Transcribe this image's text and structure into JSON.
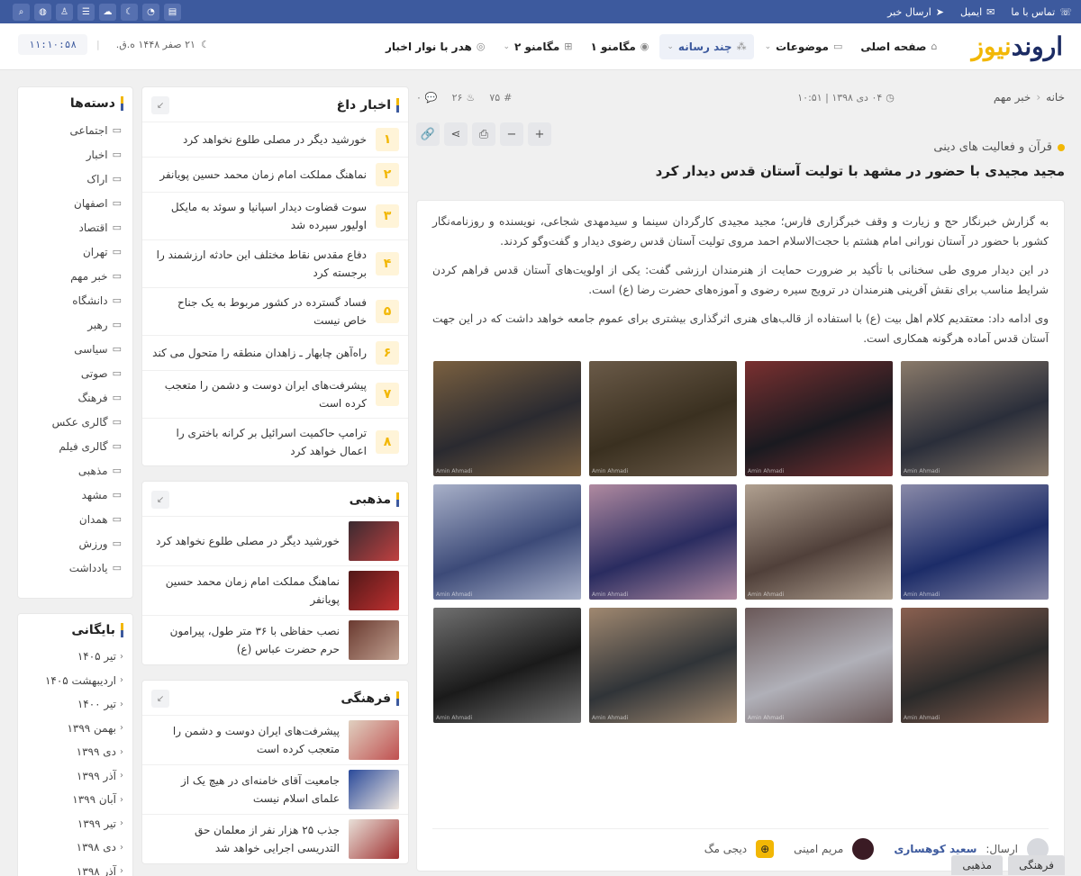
{
  "topbar": {
    "contact": "تماس با ما",
    "email": "ایمیل",
    "send_news": "ارسال خبر",
    "icons": [
      "search-icon",
      "dribbble-icon",
      "user-icon",
      "database-icon",
      "cloud-icon",
      "moon-icon",
      "rss-icon",
      "database-2-icon"
    ]
  },
  "header": {
    "logo_main": "اروند",
    "logo_accent": "نیوز",
    "nav": [
      {
        "label": "صفحه اصلی",
        "icon": "home-icon"
      },
      {
        "label": "موضوعات",
        "icon": "folder-icon",
        "dropdown": true
      },
      {
        "label": "چند رسانه",
        "icon": "grid-icon",
        "dropdown": true,
        "active": true
      },
      {
        "label": "مگامنو ۱",
        "icon": "signal-icon"
      },
      {
        "label": "مگامنو ۲",
        "icon": "sitemap-icon",
        "dropdown": true
      },
      {
        "label": "هدر با نوار اخبار",
        "icon": "target-icon"
      }
    ],
    "clock": "۱۱:۱۰:۵۸",
    "date": "۲۱ صفر ۱۴۴۸ ه.ق."
  },
  "article": {
    "breadcrumb": [
      "خانه",
      "خبر مهم"
    ],
    "date": "۰۴ دی ۱۳۹۸ | ۱۰:۵۱",
    "id": "۷۵",
    "likes": "۲۶",
    "comments": "۰",
    "kicker": "قرآن و فعالیت های دینی",
    "title": "مجید مجیدی با حضور در مشهد با تولیت آستان قدس دیدار کرد",
    "paragraphs": [
      "به گزارش خبرنگار حج و زیارت و وقف خبرگزاری فارس؛ مجید مجیدی کارگردان سینما و سیدمهدی شجاعی، نویسنده و روزنامه‌نگار کشور با حضور در آستان نورانی امام هشتم با حجت‌الاسلام احمد مروی تولیت آستان قدس رضوی دیدار و گفت‌وگو کردند.",
      "در این دیدار مروی طی سخنانی با تأکید بر ضرورت حمایت از هنرمندان ارزشی گفت: یکی از اولویت‌های آستان قدس فراهم کردن شرایط مناسب برای نقش آفرینی هنرمندان در ترویج سیره رضوی و آموزه‌های حضرت رضا (ع) است.",
      "وی ادامه داد: معتقدیم کلام اهل بیت (ع) با استفاده از قالب‌های هنری اثرگذاری بیشتری برای عموم جامعه خواهد داشت که در این جهت آستان قدس آماده هرگونه همکاری است."
    ],
    "gallery": [
      {
        "c1": "#2a2e3a",
        "c2": "#8a7a6a"
      },
      {
        "c1": "#1a1a20",
        "c2": "#7a3030"
      },
      {
        "c1": "#3a3020",
        "c2": "#6a5a48"
      },
      {
        "c1": "#2a2a30",
        "c2": "#7a6040"
      },
      {
        "c1": "#1c2c68",
        "c2": "#8a8aa8"
      },
      {
        "c1": "#50403a",
        "c2": "#b0a090"
      },
      {
        "c1": "#2a2c60",
        "c2": "#b08aa0"
      },
      {
        "c1": "#3c4a78",
        "c2": "#a8b0c8"
      },
      {
        "c1": "#2a2a2a",
        "c2": "#8a6050"
      },
      {
        "c1": "#b0b0b8",
        "c2": "#6a5858"
      },
      {
        "c1": "#303438",
        "c2": "#a08870"
      },
      {
        "c1": "#1a1a1a",
        "c2": "#707070"
      }
    ],
    "photo_caption": "Amin Ahmadi",
    "footer": {
      "sent_label": "ارسال:",
      "author": "سعید کوهساری",
      "editor": "مریم امینی",
      "source": "دیجی مگ"
    },
    "tags": [
      "فرهنگی",
      "مذهبی"
    ]
  },
  "hot_news": {
    "title": "اخبار داغ",
    "items": [
      {
        "num": "۱",
        "text": "خورشید دیگر در مصلی طلوع نخواهد کرد"
      },
      {
        "num": "۲",
        "text": "نماهنگ مملکت امام زمان محمد حسین پویانفر"
      },
      {
        "num": "۳",
        "text": "سوت قضاوت دیدار اسپانیا و سوئد به مایکل اولیور سپرده شد"
      },
      {
        "num": "۴",
        "text": "دفاع مقدس نقاط مختلف این حادثه ارزشمند را برجسته کرد"
      },
      {
        "num": "۵",
        "text": "فساد گسترده در کشور مربوط به یک جناح خاص نیست"
      },
      {
        "num": "۶",
        "text": "راه‌آهن چابهار ـ زاهدان منطقه را متحول می کند"
      },
      {
        "num": "۷",
        "text": "پیشرفت‌های ایران دوست و دشمن را متعجب کرده است"
      },
      {
        "num": "۸",
        "text": "ترامپ حاکمیت اسرائیل بر کرانه باختری را اعمال خواهد کرد"
      }
    ]
  },
  "religious": {
    "title": "مذهبی",
    "items": [
      {
        "text": "خورشید دیگر در مصلی طلوع نخواهد کرد",
        "c1": "#3a2a30",
        "c2": "#c04040"
      },
      {
        "text": "نماهنگ مملکت امام زمان محمد حسین پویانفر",
        "c1": "#501818",
        "c2": "#c03030"
      },
      {
        "text": "نصب حفاظی با ۳۶ متر طول، پیرامون حرم حضرت عباس (ع)",
        "c1": "#6a3a30",
        "c2": "#c0a090"
      }
    ]
  },
  "cultural": {
    "title": "فرهنگی",
    "items": [
      {
        "text": "پیشرفت‌های ایران دوست و دشمن را متعجب کرده است",
        "c1": "#e0d0c0",
        "c2": "#c05050"
      },
      {
        "text": "جامعیت آقای خامنه‌ای در هیچ یک از علمای اسلام نیست",
        "c1": "#2a4a9a",
        "c2": "#f0e8e0"
      },
      {
        "text": "جذب ۲۵ هزار نفر از معلمان حق التدریسی اجرایی خواهد شد",
        "c1": "#e8e0d8",
        "c2": "#a03030"
      }
    ]
  },
  "categories": {
    "title": "دسته‌ها",
    "items": [
      "اجتماعی",
      "اخبار",
      "اراک",
      "اصفهان",
      "اقتصاد",
      "تهران",
      "خبر مهم",
      "دانشگاه",
      "رهبر",
      "سیاسی",
      "صوتی",
      "فرهنگ",
      "گالری عکس",
      "گالری فیلم",
      "مذهبی",
      "مشهد",
      "همدان",
      "ورزش",
      "یادداشت"
    ]
  },
  "archive": {
    "title": "بایگانی",
    "items": [
      "تیر ۱۴۰۵",
      "اردیبهشت ۱۴۰۵",
      "تیر ۱۴۰۰",
      "بهمن ۱۳۹۹",
      "دی ۱۳۹۹",
      "آذر ۱۳۹۹",
      "آبان ۱۳۹۹",
      "تیر ۱۳۹۹",
      "دی ۱۳۹۸",
      "آذر ۱۳۹۸"
    ]
  },
  "colors": {
    "brand": "#3d5a9e",
    "accent": "#f2b705"
  }
}
